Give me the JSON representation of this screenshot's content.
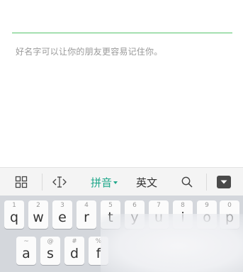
{
  "name_field": {
    "value": "",
    "hint": "好名字可以让你的朋友更容易记住你。",
    "underline_color": "#56c46a"
  },
  "ime_toolbar": {
    "pinyin_label": "拼音",
    "english_label": "英文",
    "accent_color": "#1fa78a",
    "icons": [
      "grid-icon",
      "cursor-move-icon",
      "search-icon",
      "collapse-keyboard-icon"
    ]
  },
  "keyboard": {
    "row1": [
      {
        "hint": "1",
        "letter": "q"
      },
      {
        "hint": "2",
        "letter": "w"
      },
      {
        "hint": "3",
        "letter": "e"
      },
      {
        "hint": "4",
        "letter": "r"
      },
      {
        "hint": "5",
        "letter": "t"
      },
      {
        "hint": "6",
        "letter": "y"
      },
      {
        "hint": "7",
        "letter": "u"
      },
      {
        "hint": "8",
        "letter": "i"
      },
      {
        "hint": "9",
        "letter": "o"
      },
      {
        "hint": "0",
        "letter": "p"
      }
    ],
    "row2": [
      {
        "hint": "~",
        "letter": "a"
      },
      {
        "hint": "@",
        "letter": "s"
      },
      {
        "hint": "#",
        "letter": "d"
      },
      {
        "hint": "%",
        "letter": "f"
      }
    ]
  }
}
